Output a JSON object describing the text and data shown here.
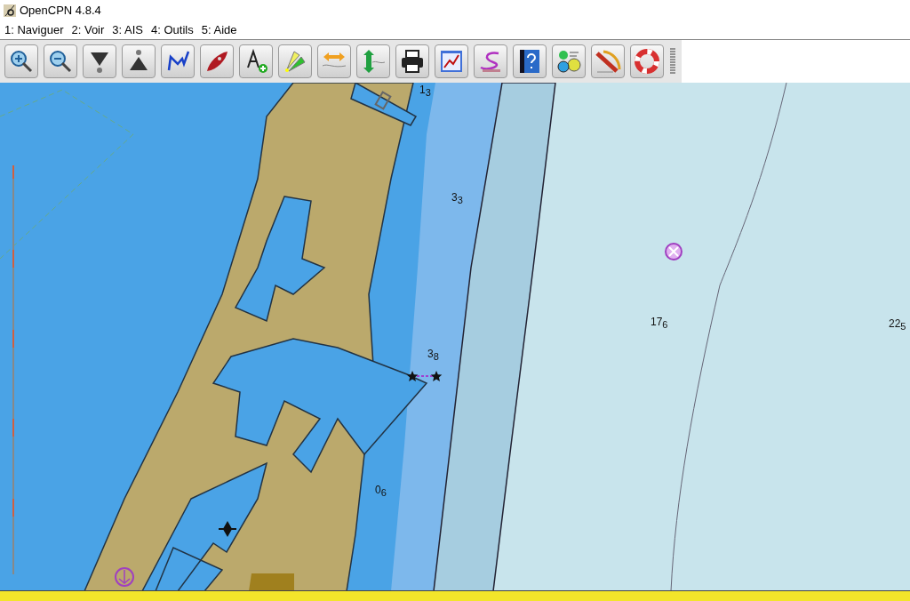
{
  "window": {
    "title": "OpenCPN 4.8.4"
  },
  "menu": [
    {
      "label": "1: Naviguer"
    },
    {
      "label": "2: Voir"
    },
    {
      "label": "3: AIS"
    },
    {
      "label": "4: Outils"
    },
    {
      "label": "5: Aide"
    }
  ],
  "chart": {
    "soundings": [
      {
        "text": "1$_{3}$"
      },
      {
        "text": "3$_{3}$"
      },
      {
        "text": "3$_{8}$"
      },
      {
        "text": "0$_{6}$"
      },
      {
        "text": "17$_{6}$"
      },
      {
        "text": "22$_{5}$"
      }
    ]
  }
}
